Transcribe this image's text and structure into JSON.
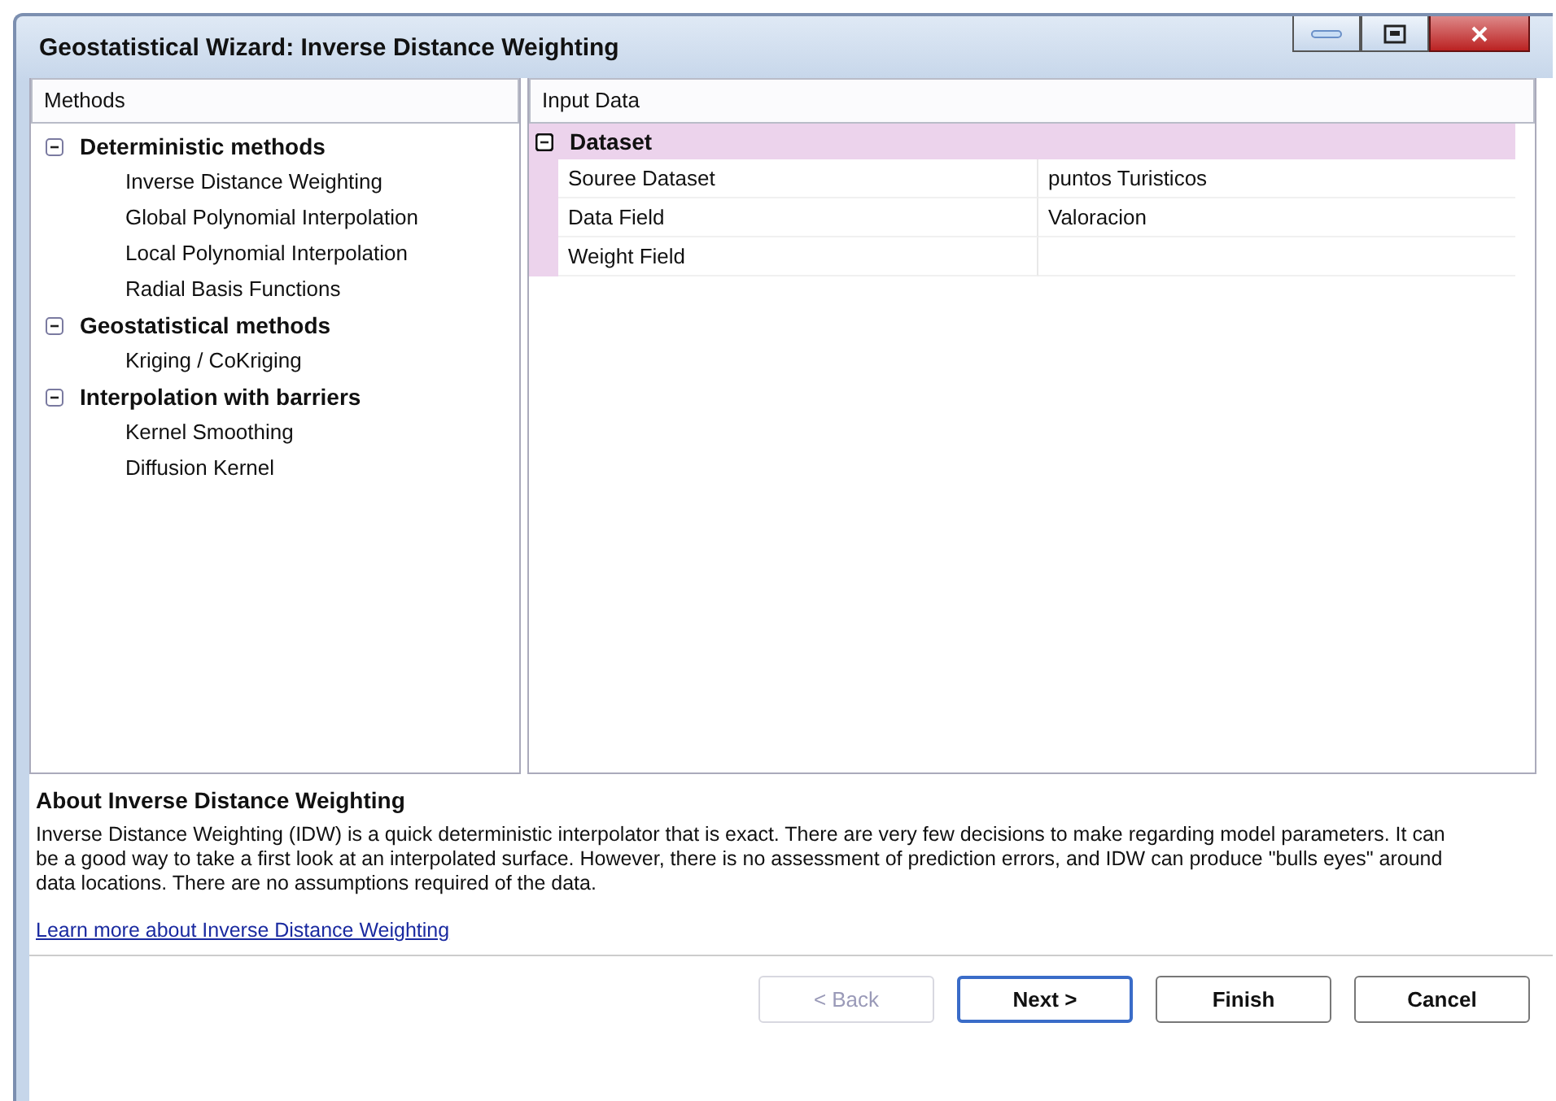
{
  "window": {
    "title": "Geostatistical Wizard: Inverse Distance Weighting"
  },
  "methods_panel": {
    "header": "Methods",
    "groups": [
      {
        "label": "Deterministic methods",
        "expanded": true,
        "children": [
          {
            "label": "Inverse Distance Weighting"
          },
          {
            "label": "Global Polynomial Interpolation"
          },
          {
            "label": "Local Polynomial Interpolation"
          },
          {
            "label": "Radial Basis Functions"
          }
        ]
      },
      {
        "label": "Geostatistical methods",
        "expanded": true,
        "children": [
          {
            "label": "Kriging / CoKriging"
          }
        ]
      },
      {
        "label": "Interpolation with barriers",
        "expanded": true,
        "children": [
          {
            "label": "Kernel Smoothing"
          },
          {
            "label": "Diffusion Kernel"
          }
        ]
      }
    ]
  },
  "input_panel": {
    "header": "Input Data",
    "section": {
      "label": "Dataset",
      "expanded": true
    },
    "rows": [
      {
        "name": "Souree Dataset",
        "value": "puntos Turisticos"
      },
      {
        "name": "Data Field",
        "value": "Valoracion"
      },
      {
        "name": "Weight Field",
        "value": ""
      }
    ]
  },
  "about": {
    "title": "About Inverse Distance Weighting",
    "text": "Inverse Distance Weighting (IDW) is a quick deterministic interpolator that is exact. There are very few decisions to make regarding model parameters. It can be a good way to take a first look at an interpolated surface. However, there is no assessment of prediction errors, and IDW can produce \"bulls eyes\" around data locations. There are no assumptions required of the data.",
    "link": "Learn more about Inverse Distance Weighting"
  },
  "buttons": [
    {
      "label": "< Back",
      "disabled": true,
      "default": false
    },
    {
      "label": "Next >",
      "disabled": false,
      "default": true
    },
    {
      "label": "Finish",
      "disabled": false,
      "default": false
    },
    {
      "label": "Cancel",
      "disabled": false,
      "default": false
    }
  ]
}
